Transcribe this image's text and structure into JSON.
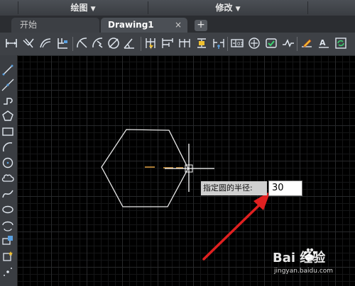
{
  "menubar": {
    "items": [
      {
        "label": "绘图",
        "arrow": "▼"
      },
      {
        "label": "修改",
        "arrow": "▼"
      }
    ]
  },
  "tabs": {
    "items": [
      {
        "label": "开始",
        "active": false
      },
      {
        "label": "Drawing1",
        "active": true,
        "close": "×"
      }
    ],
    "add_label": "+"
  },
  "toolbar": {
    "icons": [
      "linear-dimension-icon",
      "aligned-dimension-icon",
      "arc-length-icon",
      "ordinate-dimension-icon",
      "radius-dimension-icon",
      "jogged-dimension-icon",
      "diameter-dimension-icon",
      "angular-dimension-icon",
      "quick-dimension-icon",
      "baseline-dimension-icon",
      "continue-dimension-icon",
      "dimension-space-icon",
      "dimension-break-icon",
      "tolerance-icon",
      "center-mark-icon",
      "inspection-icon",
      "jogged-linear-icon",
      "dimension-edit-icon",
      "dimension-text-edit-icon",
      "dimension-update-icon"
    ]
  },
  "left_toolbar": {
    "icons": [
      "line-icon",
      "construction-line-icon",
      "polyline-icon",
      "polygon-icon",
      "rectangle-icon",
      "arc-icon",
      "circle-icon",
      "revision-cloud-icon",
      "spline-icon",
      "ellipse-icon",
      "ellipse-arc-icon",
      "insert-block-icon",
      "make-block-icon",
      "point-icon"
    ]
  },
  "canvas": {
    "prompt_label": "指定圆的半径:",
    "prompt_value": "30",
    "accent_color": "#e02020"
  },
  "watermark": {
    "brand": "Bai  经验",
    "url": "jingyan.baidu.com"
  }
}
